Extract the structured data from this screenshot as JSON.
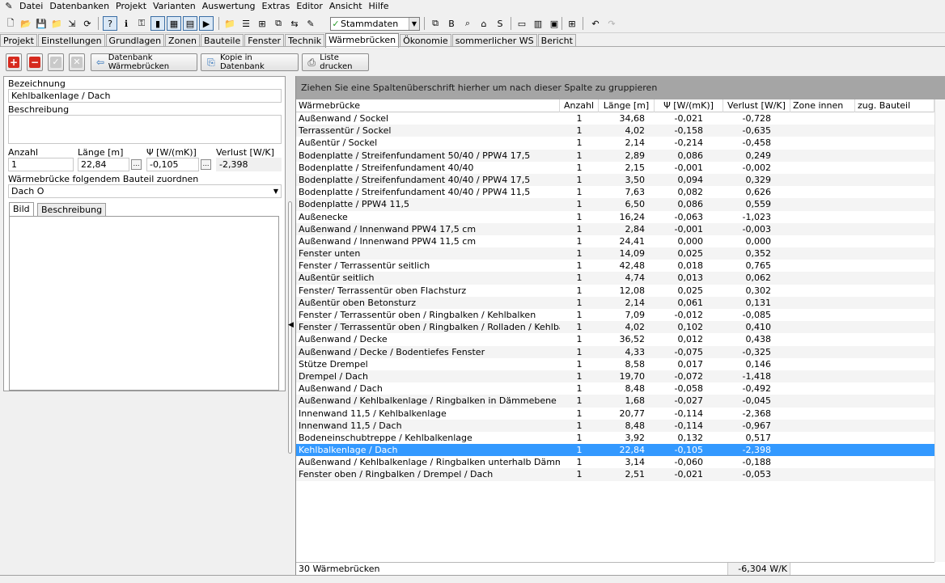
{
  "menu": [
    "Datei",
    "Datenbanken",
    "Projekt",
    "Varianten",
    "Auswertung",
    "Extras",
    "Editor",
    "Ansicht",
    "Hilfe"
  ],
  "toolbar": {
    "combo_value": "Stammdaten"
  },
  "tabs": [
    "Projekt",
    "Einstellungen",
    "Grundlagen",
    "Zonen",
    "Bauteile",
    "Fenster",
    "Technik",
    "Wärmebrücken",
    "Ökonomie",
    "sommerlicher WS",
    "Bericht"
  ],
  "active_tab": "Wärmebrücken",
  "actions": {
    "db_button": "Datenbank Wärmebrücken",
    "copy_button": "Kopie in Datenbank",
    "print_button": "Liste drucken"
  },
  "form": {
    "bezeichnung_label": "Bezeichnung",
    "bezeichnung_value": "Kehlbalkenlage / Dach",
    "beschreibung_label": "Beschreibung",
    "anzahl_label": "Anzahl",
    "anzahl_value": "1",
    "laenge_label": "Länge [m]",
    "laenge_value": "22,84",
    "psi_label": "Ψ  [W/(mK)]",
    "psi_value": "-0,105",
    "verlust_label": "Verlust [W/K]",
    "verlust_value": "-2,398",
    "zuordnen_label": "Wärmebrücke folgendem Bauteil zuordnen",
    "zuordnen_value": "Dach O",
    "inner_tabs": [
      "Bild",
      "Beschreibung"
    ]
  },
  "grid": {
    "group_hint": "Ziehen Sie eine Spaltenüberschrift hierher um nach dieser Spalte zu gruppieren",
    "columns": [
      "Wärmebrücke",
      "Anzahl",
      "Länge [m]",
      "Ψ [W/(mK)]",
      "Verlust [W/K]",
      "Zone innen",
      "zug. Bauteil"
    ],
    "rows": [
      [
        "Außenwand / Sockel",
        "1",
        "34,68",
        "-0,021",
        "-0,728"
      ],
      [
        "Terrassentür / Sockel",
        "1",
        "4,02",
        "-0,158",
        "-0,635"
      ],
      [
        "Außentür / Sockel",
        "1",
        "2,14",
        "-0,214",
        "-0,458"
      ],
      [
        "Bodenplatte / Streifenfundament 50/40 / PPW4 17,5",
        "1",
        "2,89",
        "0,086",
        "0,249"
      ],
      [
        "Bodenplatte / Streifenfundament 40/40",
        "1",
        "2,15",
        "-0,001",
        "-0,002"
      ],
      [
        "Bodenplatte / Streifenfundament 40/40 / PPW4 17,5",
        "1",
        "3,50",
        "0,094",
        "0,329"
      ],
      [
        "Bodenplatte / Streifenfundament 40/40 / PPW4 11,5",
        "1",
        "7,63",
        "0,082",
        "0,626"
      ],
      [
        "Bodenplatte /  PPW4 11,5",
        "1",
        "6,50",
        "0,086",
        "0,559"
      ],
      [
        "Außenecke",
        "1",
        "16,24",
        "-0,063",
        "-1,023"
      ],
      [
        "Außenwand / Innenwand PPW4 17,5 cm",
        "1",
        "2,84",
        "-0,001",
        "-0,003"
      ],
      [
        "Außenwand / Innenwand PPW4 11,5 cm",
        "1",
        "24,41",
        "0,000",
        "0,000"
      ],
      [
        "Fenster unten",
        "1",
        "14,09",
        "0,025",
        "0,352"
      ],
      [
        "Fenster / Terrassentür seitlich",
        "1",
        "42,48",
        "0,018",
        "0,765"
      ],
      [
        "Außentür seitlich",
        "1",
        "4,74",
        "0,013",
        "0,062"
      ],
      [
        "Fenster/ Terrassentür oben Flachsturz",
        "1",
        "12,08",
        "0,025",
        "0,302"
      ],
      [
        "Außentür oben Betonsturz",
        "1",
        "2,14",
        "0,061",
        "0,131"
      ],
      [
        "Fenster / Terrassentür oben /  Ringbalken / Kehlbalken",
        "1",
        "7,09",
        "-0,012",
        "-0,085"
      ],
      [
        "Fenster / Terrassentür oben / Ringbalken / Rolladen / Kehlbalken",
        "1",
        "4,02",
        "0,102",
        "0,410"
      ],
      [
        "Außenwand / Decke",
        "1",
        "36,52",
        "0,012",
        "0,438"
      ],
      [
        "Außenwand / Decke / Bodentiefes Fenster",
        "1",
        "4,33",
        "-0,075",
        "-0,325"
      ],
      [
        "Stütze Drempel",
        "1",
        "8,58",
        "0,017",
        "0,146"
      ],
      [
        "Drempel / Dach",
        "1",
        "19,70",
        "-0,072",
        "-1,418"
      ],
      [
        "Außenwand / Dach",
        "1",
        "8,48",
        "-0,058",
        "-0,492"
      ],
      [
        "Außenwand / Kehlbalkenlage / Ringbalken in Dämmebene",
        "1",
        "1,68",
        "-0,027",
        "-0,045"
      ],
      [
        "Innenwand 11,5 / Kehlbalkenlage",
        "1",
        "20,77",
        "-0,114",
        "-2,368"
      ],
      [
        "Innenwand 11,5 / Dach",
        "1",
        "8,48",
        "-0,114",
        "-0,967"
      ],
      [
        "Bodeneinschubtreppe / Kehlbalkenlage",
        "1",
        "3,92",
        "0,132",
        "0,517"
      ],
      [
        "Kehlbalkenlage / Dach",
        "1",
        "22,84",
        "-0,105",
        "-2,398"
      ],
      [
        "Außenwand / Kehlbalkenlage / Ringbalken unterhalb Dämmebene",
        "1",
        "3,14",
        "-0,060",
        "-0,188"
      ],
      [
        "Fenster oben / Ringbalken / Drempel / Dach",
        "1",
        "2,51",
        "-0,021",
        "-0,053"
      ]
    ],
    "selected_index": 27,
    "footer_count": "30 Wärmebrücken",
    "footer_total": "-6,304 W/K"
  }
}
